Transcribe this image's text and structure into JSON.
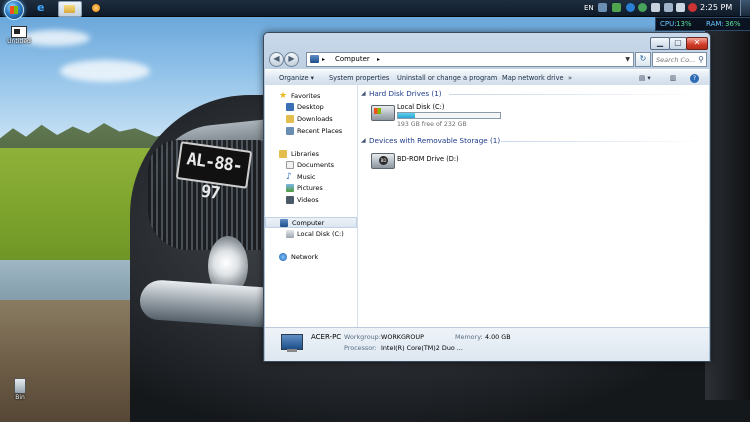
{
  "taskbar": {
    "language": "EN",
    "clock": "2:25 PM",
    "apps": [
      "ie-icon",
      "explorer-icon",
      "media-player-icon"
    ]
  },
  "gadget": {
    "cpu_label": "CPU:",
    "cpu_value": "13%",
    "ram_label": "RAM:",
    "ram_value": "36%"
  },
  "desktop": {
    "icons": [
      {
        "label": "Untitled",
        "icon": "file-icon"
      },
      {
        "label": "Bin",
        "icon": "recycle-bin-icon"
      }
    ],
    "wallpaper_plate": "AL-88-97"
  },
  "window": {
    "address": {
      "location": "Computer",
      "separator": "▸"
    },
    "search_placeholder": "Search Co...",
    "toolbar": {
      "organize": "Organize",
      "system_properties": "System properties",
      "uninstall": "Uninstall or change a program",
      "map_drive": "Map network drive",
      "more": "»"
    },
    "nav": {
      "favorites": "Favorites",
      "desktop": "Desktop",
      "downloads": "Downloads",
      "recent": "Recent Places",
      "libraries": "Libraries",
      "documents": "Documents",
      "music": "Music",
      "pictures": "Pictures",
      "videos": "Videos",
      "computer": "Computer",
      "local_disk": "Local Disk (C:)",
      "network": "Network"
    },
    "groups": {
      "hdd_header": "Hard Disk Drives (1)",
      "removable_header": "Devices with Removable Storage (1)"
    },
    "drives": {
      "c_label": "Local Disk (C:)",
      "c_free": "193 GB free of 232 GB",
      "c_used_fraction": 0.168,
      "d_label": "BD-ROM Drive (D:)"
    },
    "details": {
      "name": "ACER-PC",
      "workgroup_key": "Workgroup:",
      "workgroup_val": "WORKGROUP",
      "memory_key": "Memory:",
      "memory_val": "4.00 GB",
      "processor_key": "Processor:",
      "processor_val": "Intel(R) Core(TM)2 Duo ..."
    }
  }
}
